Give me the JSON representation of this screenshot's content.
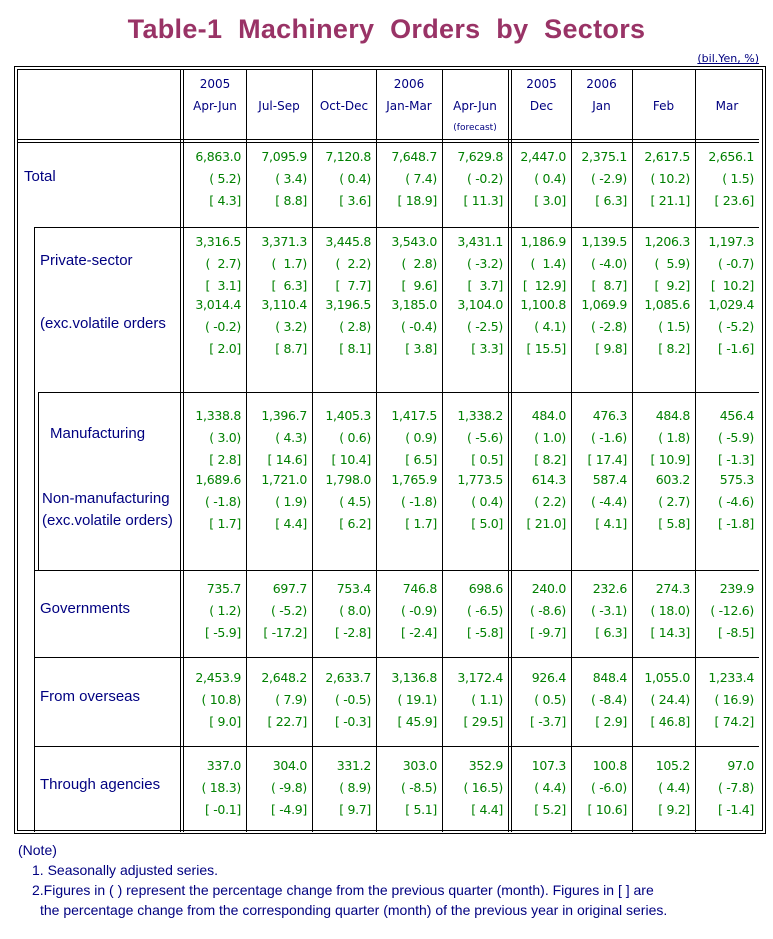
{
  "title": "Table-1  Machinery  Orders  by  Sectors",
  "unit": "(bil.Yen, %)",
  "columns": [
    {
      "year": "2005",
      "period": "Apr-Jun",
      "note": ""
    },
    {
      "year": "",
      "period": "Jul-Sep",
      "note": ""
    },
    {
      "year": "",
      "period": "Oct-Dec",
      "note": ""
    },
    {
      "year": "2006",
      "period": "Jan-Mar",
      "note": ""
    },
    {
      "year": "",
      "period": "Apr-Jun",
      "note": "(forecast)"
    },
    {
      "year": "2005",
      "period": "Dec",
      "note": ""
    },
    {
      "year": "2006",
      "period": "Jan",
      "note": ""
    },
    {
      "year": "",
      "period": "Feb",
      "note": ""
    },
    {
      "year": "",
      "period": "Mar",
      "note": ""
    }
  ],
  "rows": [
    {
      "label": "Total",
      "label2": "",
      "values": [
        "6,863.0",
        "7,095.9",
        "7,120.8",
        "7,648.7",
        "7,629.8",
        "2,447.0",
        "2,375.1",
        "2,617.5",
        "2,656.1"
      ],
      "qoq": [
        "( 5.2)",
        "( 3.4)",
        "( 0.4)",
        "( 7.4)",
        "( -0.2)",
        "( 0.4)",
        "( -2.9)",
        "( 10.2)",
        "( 1.5)"
      ],
      "yoy": [
        "[ 4.3]",
        "[ 8.8]",
        "[ 3.6]",
        "[ 18.9]",
        "[ 11.3]",
        "[ 3.0]",
        "[ 6.3]",
        "[ 21.1]",
        "[ 23.6]"
      ]
    },
    {
      "label": "Private-sector",
      "label2": "",
      "values": [
        "3,316.5",
        "3,371.3",
        "3,445.8",
        "3,543.0",
        "3,431.1",
        "1,186.9",
        "1,139.5",
        "1,206.3",
        "1,197.3"
      ],
      "qoq": [
        "(  2.7)",
        "(  1.7)",
        "(  2.2)",
        "(  2.8)",
        "( -3.2)",
        "(  1.4)",
        "( -4.0)",
        "(  5.9)",
        "( -0.7)"
      ],
      "yoy": [
        "[  3.1]",
        "[  6.3]",
        "[  7.7]",
        "[  9.6]",
        "[  3.7]",
        "[  12.9]",
        "[  8.7]",
        "[  9.2]",
        "[  10.2]"
      ]
    },
    {
      "label": "(exc.volatile orders",
      "label2": "",
      "values": [
        "3,014.4",
        "3,110.4",
        "3,196.5",
        "3,185.0",
        "3,104.0",
        "1,100.8",
        "1,069.9",
        "1,085.6",
        "1,029.4"
      ],
      "qoq": [
        "( -0.2)",
        "( 3.2)",
        "( 2.8)",
        "( -0.4)",
        "( -2.5)",
        "( 4.1)",
        "( -2.8)",
        "( 1.5)",
        "( -5.2)"
      ],
      "yoy": [
        "[ 2.0]",
        "[ 8.7]",
        "[ 8.1]",
        "[ 3.8]",
        "[ 3.3]",
        "[ 15.5]",
        "[ 9.8]",
        "[ 8.2]",
        "[ -1.6]"
      ]
    },
    {
      "label": "Manufacturing",
      "label2": "",
      "values": [
        "1,338.8",
        "1,396.7",
        "1,405.3",
        "1,417.5",
        "1,338.2",
        "484.0",
        "476.3",
        "484.8",
        "456.4"
      ],
      "qoq": [
        "( 3.0)",
        "( 4.3)",
        "( 0.6)",
        "( 0.9)",
        "( -5.6)",
        "( 1.0)",
        "( -1.6)",
        "( 1.8)",
        "( -5.9)"
      ],
      "yoy": [
        "[ 2.8]",
        "[ 14.6]",
        "[ 10.4]",
        "[ 6.5]",
        "[ 0.5]",
        "[ 8.2]",
        "[ 17.4]",
        "[ 10.9]",
        "[ -1.3]"
      ]
    },
    {
      "label": "Non-manufacturing",
      "label2": "(exc.volatile orders)",
      "values": [
        "1,689.6",
        "1,721.0",
        "1,798.0",
        "1,765.9",
        "1,773.5",
        "614.3",
        "587.4",
        "603.2",
        "575.3"
      ],
      "qoq": [
        "( -1.8)",
        "( 1.9)",
        "( 4.5)",
        "( -1.8)",
        "( 0.4)",
        "( 2.2)",
        "( -4.4)",
        "( 2.7)",
        "( -4.6)"
      ],
      "yoy": [
        "[ 1.7]",
        "[ 4.4]",
        "[ 6.2]",
        "[ 1.7]",
        "[ 5.0]",
        "[ 21.0]",
        "[ 4.1]",
        "[ 5.8]",
        "[ -1.8]"
      ]
    },
    {
      "label": "Governments",
      "label2": "",
      "values": [
        "735.7",
        "697.7",
        "753.4",
        "746.8",
        "698.6",
        "240.0",
        "232.6",
        "274.3",
        "239.9"
      ],
      "qoq": [
        "( 1.2)",
        "( -5.2)",
        "( 8.0)",
        "( -0.9)",
        "( -6.5)",
        "( -8.6)",
        "( -3.1)",
        "( 18.0)",
        "( -12.6)"
      ],
      "yoy": [
        "[ -5.9]",
        "[ -17.2]",
        "[ -2.8]",
        "[ -2.4]",
        "[ -5.8]",
        "[ -9.7]",
        "[ 6.3]",
        "[ 14.3]",
        "[ -8.5]"
      ]
    },
    {
      "label": "From overseas",
      "label2": "",
      "values": [
        "2,453.9",
        "2,648.2",
        "2,633.7",
        "3,136.8",
        "3,172.4",
        "926.4",
        "848.4",
        "1,055.0",
        "1,233.4"
      ],
      "qoq": [
        "( 10.8)",
        "( 7.9)",
        "( -0.5)",
        "( 19.1)",
        "( 1.1)",
        "( 0.5)",
        "( -8.4)",
        "( 24.4)",
        "( 16.9)"
      ],
      "yoy": [
        "[ 9.0]",
        "[ 22.7]",
        "[ -0.3]",
        "[ 45.9]",
        "[ 29.5]",
        "[ -3.7]",
        "[ 2.9]",
        "[ 46.8]",
        "[ 74.2]"
      ]
    },
    {
      "label": "Through agencies",
      "label2": "",
      "values": [
        "337.0",
        "304.0",
        "331.2",
        "303.0",
        "352.9",
        "107.3",
        "100.8",
        "105.2",
        "97.0"
      ],
      "qoq": [
        "( 18.3)",
        "( -9.8)",
        "( 8.9)",
        "( -8.5)",
        "( 16.5)",
        "( 4.4)",
        "( -6.0)",
        "( 4.4)",
        "( -7.8)"
      ],
      "yoy": [
        "[ -0.1]",
        "[ -4.9]",
        "[ 9.7]",
        "[ 5.1]",
        "[ 4.4]",
        "[ 5.2]",
        "[ 10.6]",
        "[ 9.2]",
        "[ -1.4]"
      ]
    }
  ],
  "notes": {
    "heading": "(Note)",
    "items": [
      "1. Seasonally adjusted series.",
      "2.Figures in ( ) represent the percentage change from the previous quarter (month). Figures in [ ] are",
      "the percentage change from the corresponding quarter (month) of the previous year in original series."
    ]
  }
}
